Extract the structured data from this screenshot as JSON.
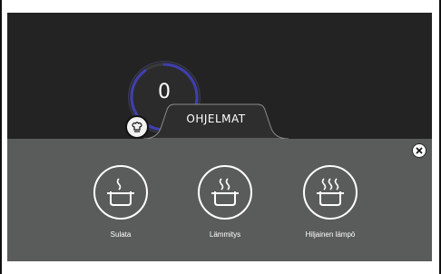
{
  "dial": {
    "value": "0",
    "level": 0.9
  },
  "tab": {
    "label": "OHJELMAT"
  },
  "programs": [
    {
      "label": "Sulata",
      "icon": "pot-low-steam-icon"
    },
    {
      "label": "Lämmitys",
      "icon": "pot-medium-steam-icon"
    },
    {
      "label": "Hiljainen lämpö",
      "icon": "pot-high-steam-icon"
    }
  ],
  "colors": {
    "background": "#232323",
    "panel": "#5a5b5b",
    "dial_ring": "#3f3fb0",
    "foreground": "#ffffff"
  }
}
